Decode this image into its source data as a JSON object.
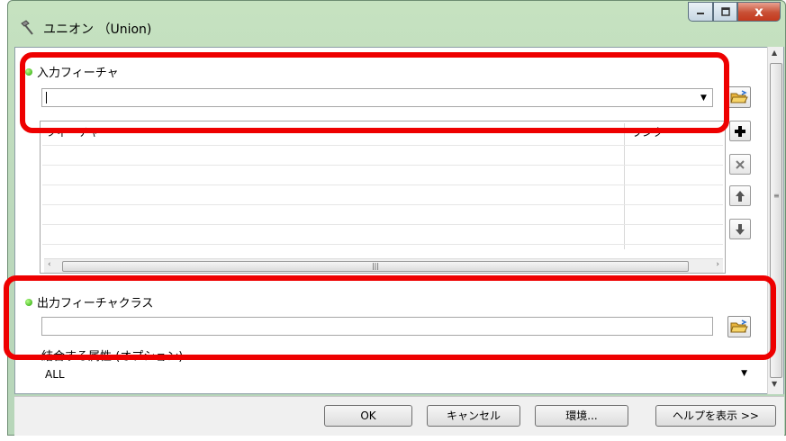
{
  "window": {
    "title": "ユニオン （Union)",
    "minimize_icon": "minimize-icon",
    "maximize_icon": "maximize-icon",
    "close_label": "x"
  },
  "input_features": {
    "label": "入力フィーチャ",
    "value": "",
    "table": {
      "columns": [
        "フィーチャ",
        "ランク"
      ],
      "rows": []
    }
  },
  "side_buttons": [
    "add-icon",
    "remove-icon",
    "move-up-icon",
    "move-down-icon"
  ],
  "output_feature_class": {
    "label": "出力フィーチャクラス",
    "value": ""
  },
  "join_attributes": {
    "label": "結合する属性 (オプション)",
    "value": "ALL"
  },
  "footer": {
    "ok": "OK",
    "cancel": "キャンセル",
    "environments": "環境...",
    "show_help": "ヘルプを表示 >>"
  },
  "colors": {
    "highlight": "#ee0000",
    "required_dot": "#21a000",
    "title_bar": "#c6e2c0"
  }
}
